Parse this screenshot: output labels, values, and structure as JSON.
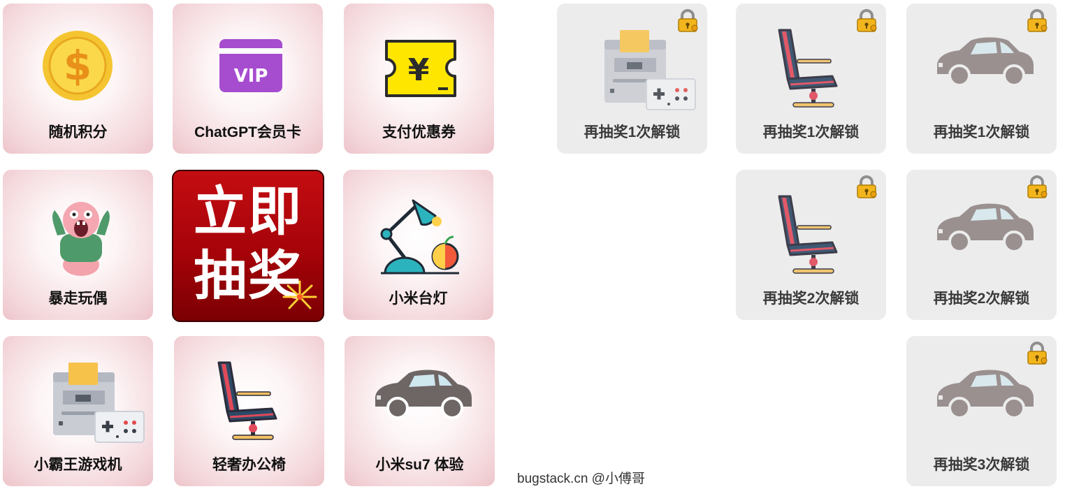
{
  "prizes": [
    {
      "label": "随机积分",
      "icon": "gold-coin-icon"
    },
    {
      "label": "ChatGPT会员卡",
      "icon": "vip-card-icon"
    },
    {
      "label": "支付优惠券",
      "icon": "yen-coupon-icon"
    },
    {
      "label": "暴走玩偶",
      "icon": "monster-doll-icon"
    },
    {
      "label": "小米台灯",
      "icon": "desk-lamp-icon"
    },
    {
      "label": "小霸王游戏机",
      "icon": "game-console-icon"
    },
    {
      "label": "轻奢办公椅",
      "icon": "office-chair-icon"
    },
    {
      "label": "小米su7 体验",
      "icon": "car-icon"
    }
  ],
  "draw_button": {
    "line1": "立即",
    "line2": "抽奖",
    "icon": "fireworks-icon"
  },
  "locked": [
    {
      "label": "再抽奖1次解锁",
      "icon": "game-console-icon"
    },
    {
      "label": "再抽奖1次解锁",
      "icon": "office-chair-icon"
    },
    {
      "label": "再抽奖1次解锁",
      "icon": "car-icon"
    },
    {
      "label": "再抽奖2次解锁",
      "icon": "office-chair-icon"
    },
    {
      "label": "再抽奖2次解锁",
      "icon": "car-icon"
    },
    {
      "label": "再抽奖3次解锁",
      "icon": "car-icon"
    }
  ],
  "footer": "bugstack.cn @小傅哥",
  "colors": {
    "prize_bg": "#f3d6da",
    "locked_bg": "#ececec",
    "draw_red": "#a50309"
  }
}
